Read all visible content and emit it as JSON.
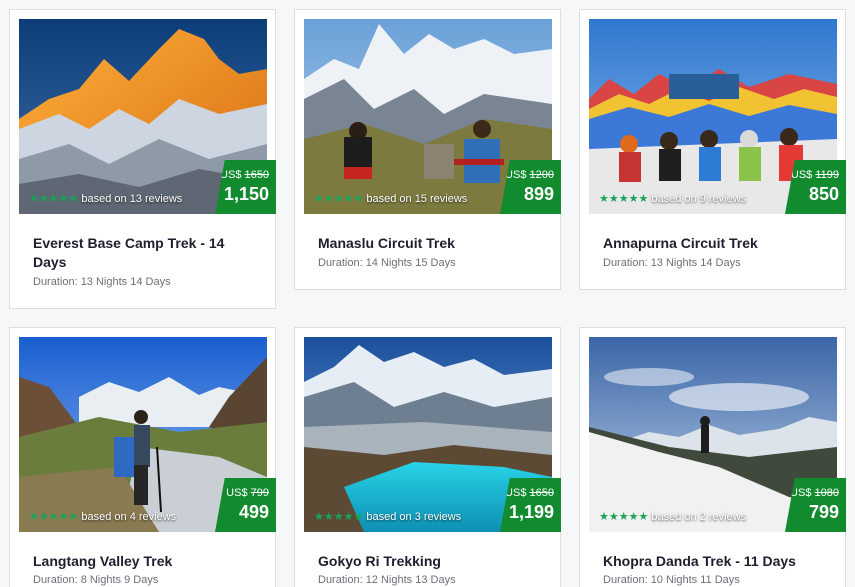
{
  "currency_label": "US$",
  "stars_icon": "star-icon",
  "accent_color": "#128a2e",
  "star_color": "#19a35a",
  "cards": [
    {
      "title": "Everest Base Camp Trek - 14 Days",
      "duration": "Duration: 13 Nights 14 Days",
      "reviews": "based on 13 reviews",
      "old_price": "1650",
      "price": "1,150",
      "rating": 5
    },
    {
      "title": "Manaslu Circuit Trek",
      "duration": "Duration: 14 Nights 15 Days",
      "reviews": "based on 15 reviews",
      "old_price": "1200",
      "price": "899",
      "rating": 5
    },
    {
      "title": "Annapurna Circuit Trek",
      "duration": "Duration: 13 Nights 14 Days",
      "reviews": "based on 9 reviews",
      "old_price": "1199",
      "price": "850",
      "rating": 5
    },
    {
      "title": "Langtang Valley Trek",
      "duration": "Duration: 8 Nights 9 Days",
      "reviews": "based on 4 reviews",
      "old_price": "799",
      "price": "499",
      "rating": 5
    },
    {
      "title": "Gokyo Ri Trekking",
      "duration": "Duration: 12 Nights 13 Days",
      "reviews": "based on 3 reviews",
      "old_price": "1650",
      "price": "1,199",
      "rating": 5
    },
    {
      "title": "Khopra Danda Trek - 11 Days",
      "duration": "Duration: 10 Nights 11 Days",
      "reviews": "based on 2 reviews",
      "old_price": "1080",
      "price": "799",
      "rating": 5
    }
  ]
}
